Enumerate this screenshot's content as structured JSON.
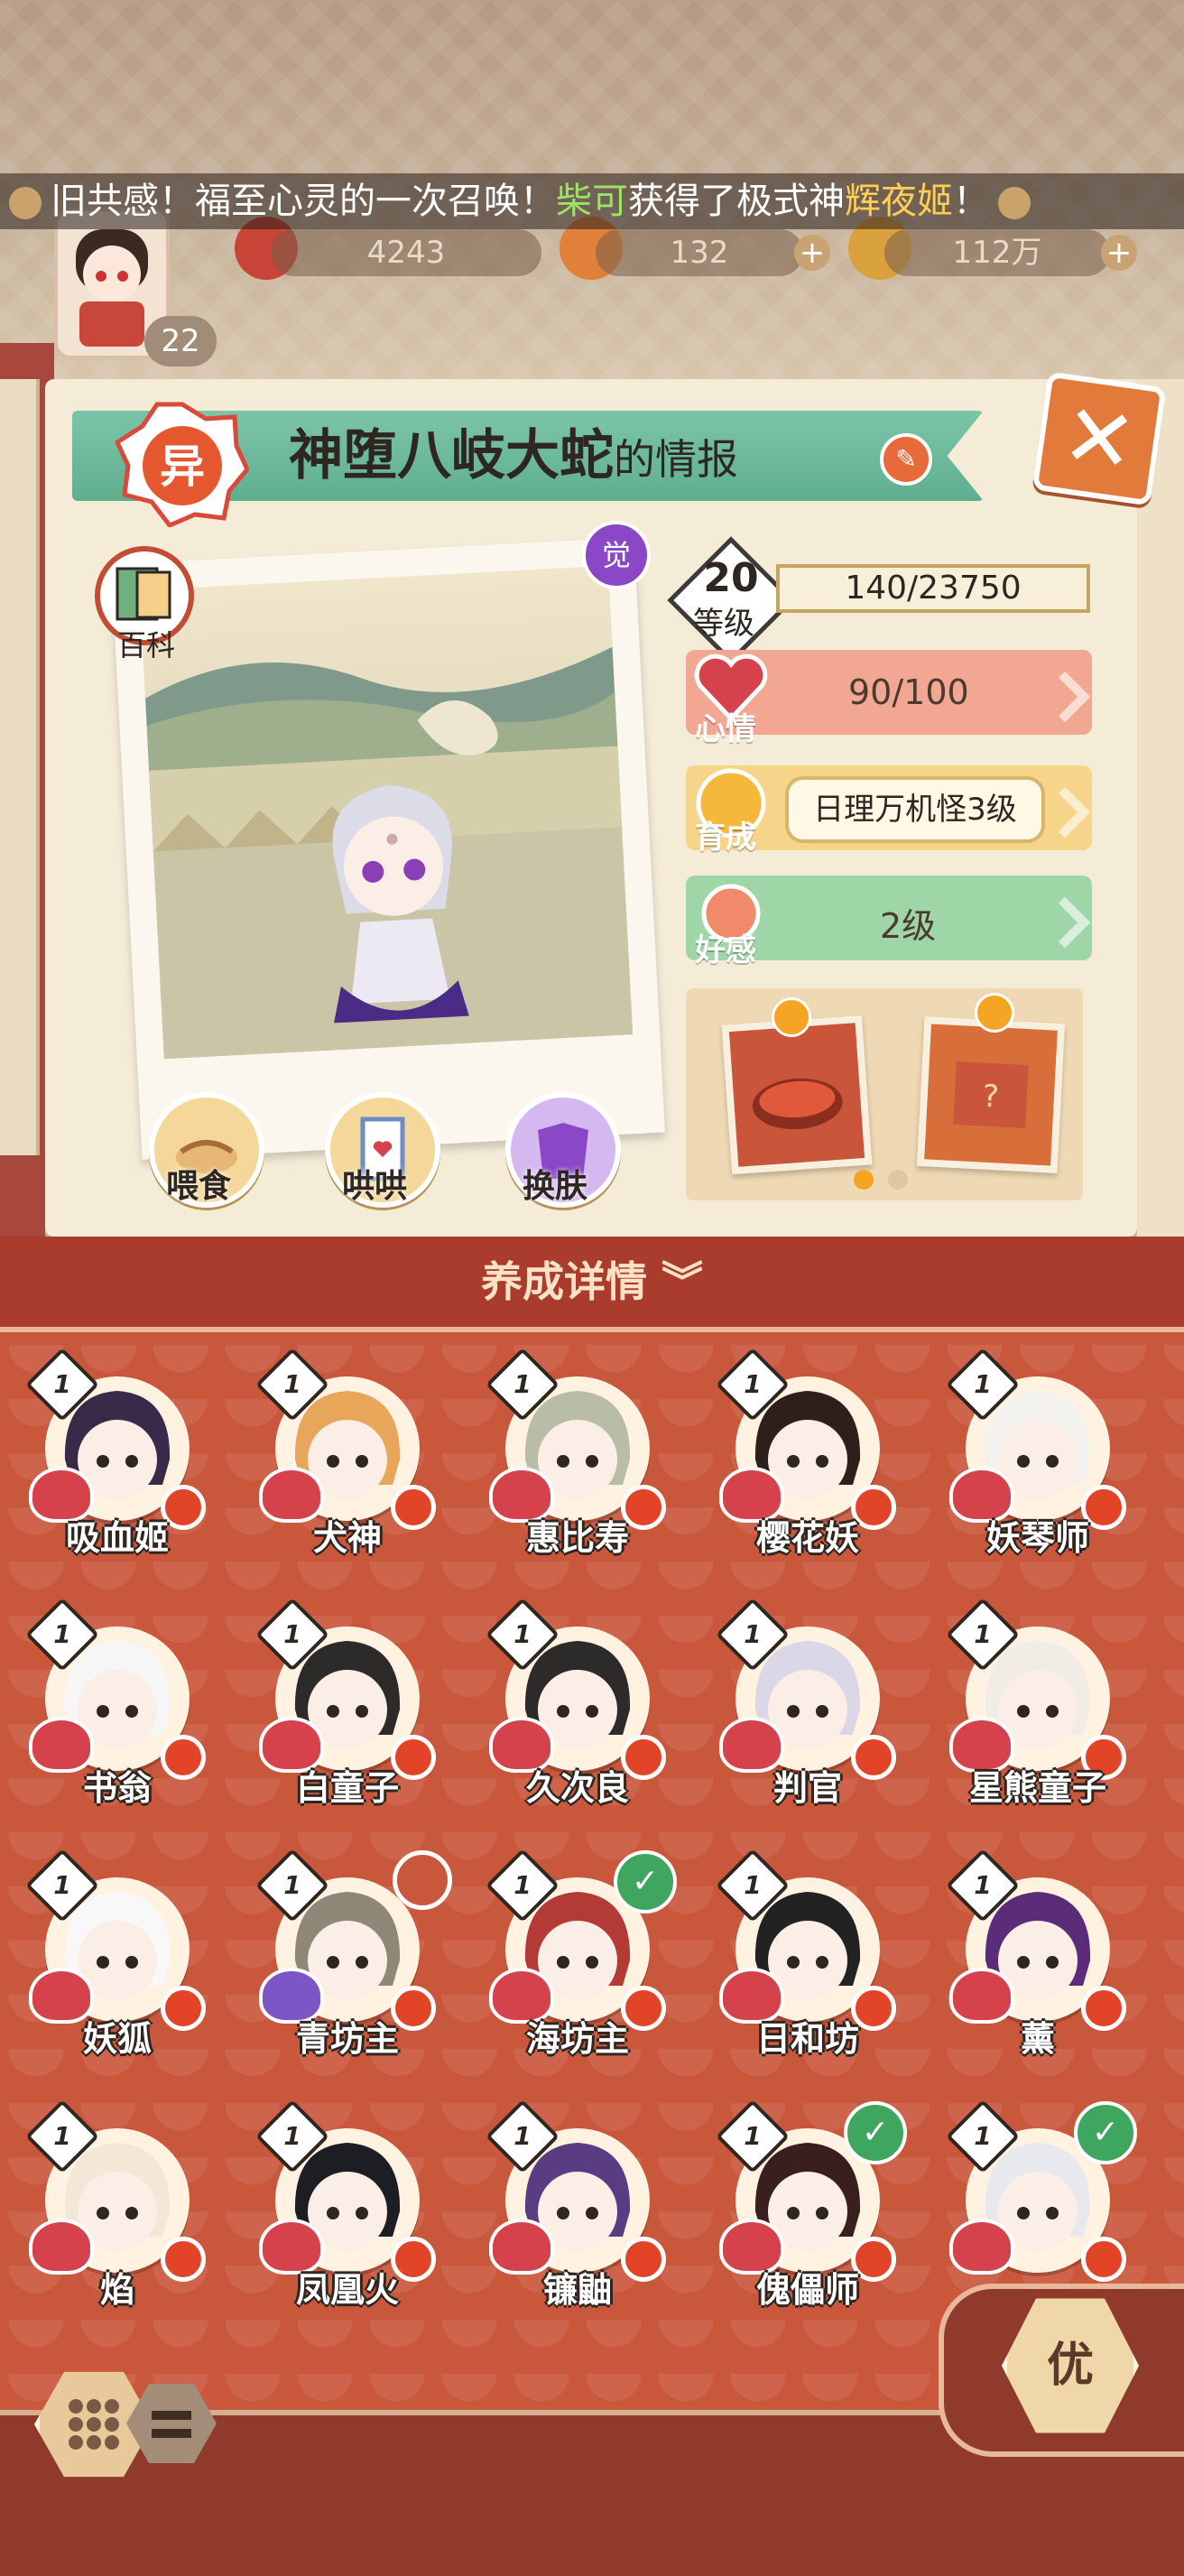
{
  "banner": {
    "prefix": "旧共感！福至心灵的一次召唤！",
    "player": "柴可",
    "middle": "获得了极式神",
    "shikigami": "辉夜姬",
    "suffix": "！"
  },
  "resources": {
    "currency1": "4243",
    "currency2": "132",
    "currency3": "112万"
  },
  "player": {
    "level": "22"
  },
  "header": {
    "rank_badge": "异",
    "name": "神堕八岐大蛇",
    "suffix": "的情报"
  },
  "photo": {
    "awaken_badge": "觉",
    "encyclopedia_label": "百科",
    "actions": [
      "喂食",
      "哄哄",
      "换肤"
    ]
  },
  "stats": {
    "level_value": "20",
    "level_label": "等级",
    "exp": "140/23750",
    "mood_label": "心情",
    "mood_value": "90/100",
    "train_label": "育成",
    "train_value": "日理万机怪3级",
    "favor_label": "好感",
    "favor_value": "2级"
  },
  "gifts": {
    "pager_active": 0,
    "pager_count": 2
  },
  "section": {
    "title": "养成详情"
  },
  "roster": [
    {
      "name": "吸血姬",
      "level": "1"
    },
    {
      "name": "犬神",
      "level": "1"
    },
    {
      "name": "惠比寿",
      "level": "1"
    },
    {
      "name": "樱花妖",
      "level": "1"
    },
    {
      "name": "妖琴师",
      "level": "1"
    },
    {
      "name": "书翁",
      "level": "1"
    },
    {
      "name": "白童子",
      "level": "1"
    },
    {
      "name": "久次良",
      "level": "1"
    },
    {
      "name": "判官",
      "level": "1"
    },
    {
      "name": "星熊童子",
      "level": "1"
    },
    {
      "name": "妖狐",
      "level": "1"
    },
    {
      "name": "青坊主",
      "level": "1"
    },
    {
      "name": "海坊主",
      "level": "1"
    },
    {
      "name": "日和坊",
      "level": "1"
    },
    {
      "name": "薰",
      "level": "1"
    },
    {
      "name": "焰",
      "level": "1"
    },
    {
      "name": "凤凰火",
      "level": "1"
    },
    {
      "name": "镰鼬",
      "level": "1"
    },
    {
      "name": "傀儡师",
      "level": "1"
    },
    {
      "name": "",
      "level": "1"
    }
  ],
  "bottom": {
    "priority_label": "优"
  }
}
